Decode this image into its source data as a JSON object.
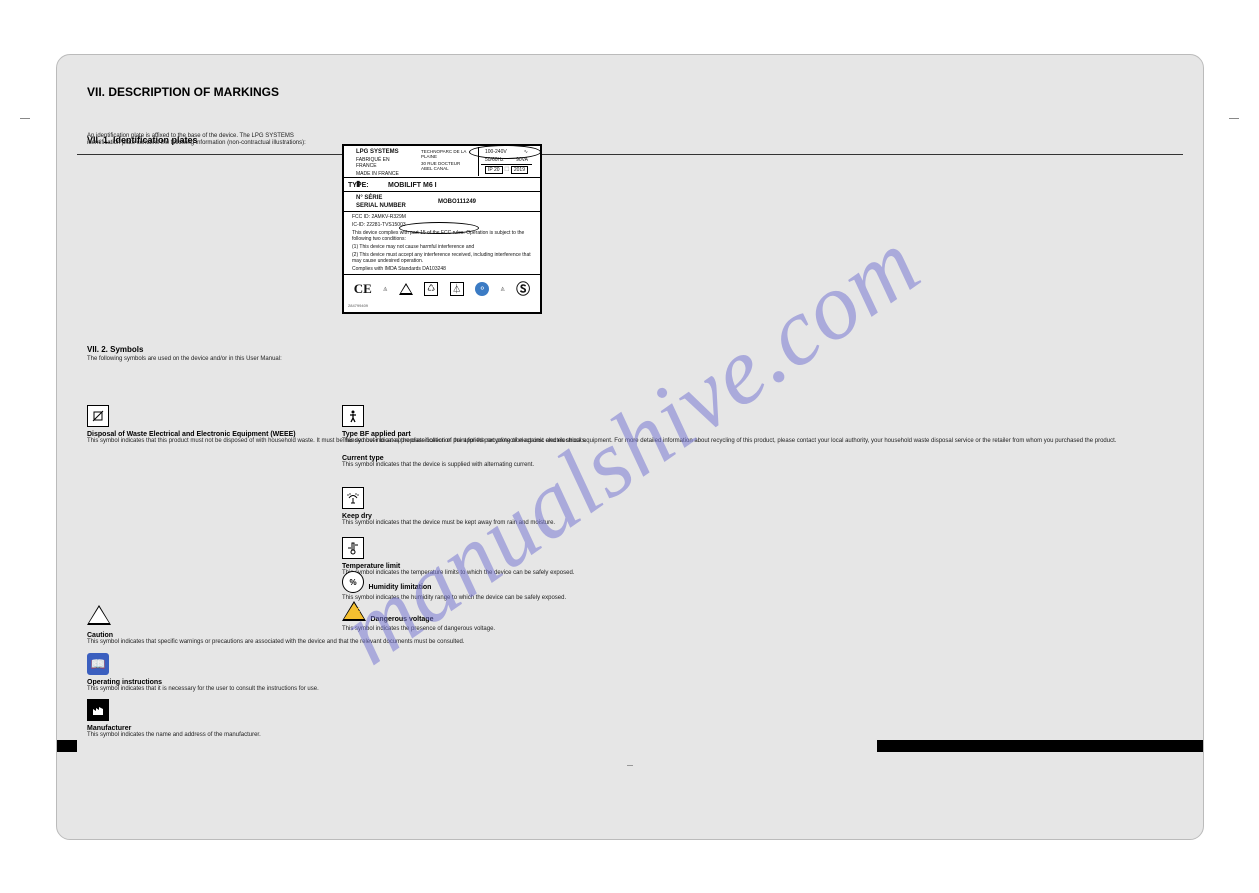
{
  "watermark": "manualshive.com",
  "header": {
    "title": "VII. DESCRIPTION OF MARKINGS",
    "subtitle": "VII. 1. Identification plates",
    "text": "An identification plate is affixed to the base of the device. The LPG SYSTEMS identification plate contains the following information (non-contractual illustrations):"
  },
  "plate": {
    "brand": "LPG SYSTEMS",
    "addr1": "TECHNOPARC DE LA PLAINE",
    "addr2": "30 RUE DOCTEUR ABEL CANAL",
    "made": "FABRIQUÉ EN FRANCE",
    "made2": "MADE IN FRANCE",
    "volt": "100-240V",
    "hz": "50/60Hz",
    "va": "90VA",
    "ip": "IP 20",
    "year": "2019",
    "type_label": "TYPE:",
    "type_value": "MOBILIFT M6 I",
    "serial_label_fr": "N° SÉRIE",
    "serial_label_en": "SERIAL NUMBER",
    "serial_value": "MOBO111249",
    "fcc1": "FCC ID: 2AMKV-R329M",
    "fcc2": "IC-ID: 22281-TVS15003",
    "fcc3": "This device complies with part 15 of the FCC rules. Operation is subject to the following two conditions:",
    "fcc4": "(1) This device may not cause harmful interference and",
    "fcc5": "(2) This device must accept any interference received, including interference that may cause undesired operation.",
    "fcc6": "Complies with IMDA Standards DA103248",
    "footer": "284799409"
  },
  "sections": {
    "sym_title": "VII. 2. Symbols",
    "sym_text": "The following symbols are used on the device and/or in this User Manual:",
    "weee_t": "Disposal of Waste Electrical and Electronic Equipment (WEEE)",
    "weee_x": "This symbol indicates that this product must not be disposed of with household waste. It must be handed over to an appropriate collection point for the recycling of electronic and electrical equipment. For more detailed information about recycling of this product, please contact your local authority, your household waste disposal service or the retailer from whom you purchased the product.",
    "caution_t": "Caution",
    "caution_x": "This symbol indicates that specific warnings or precautions are associated with the device and that the relevant documents must be consulted.",
    "ifu_t": "Operating instructions",
    "ifu_x": "This symbol indicates that it is necessary for the user to consult the instructions for use.",
    "mfr_t": "Manufacturer",
    "mfr_x": "This symbol indicates the name and address of the manufacturer.",
    "bf_t": "Type BF applied part",
    "bf_x": "This symbol indicates the classification of the applied part protection against electric shocks.",
    "alt_t": "Current type",
    "alt_x": "This symbol indicates that the device is supplied with alternating current.",
    "dry_t": "Keep dry",
    "dry_x": "This symbol indicates that the device must be kept away from rain and moisture.",
    "temp_t": "Temperature limit",
    "temp_x": "This symbol indicates the temperature limits to which the device can be safely exposed.",
    "hum_t": "Humidity limitation",
    "hum_x": "This symbol indicates the humidity range to which the device can be safely exposed.",
    "volt_t": "Dangerous voltage",
    "volt_x": "This symbol indicates the presence of dangerous voltage."
  },
  "footer": {
    "page": "—",
    "ref": ""
  }
}
